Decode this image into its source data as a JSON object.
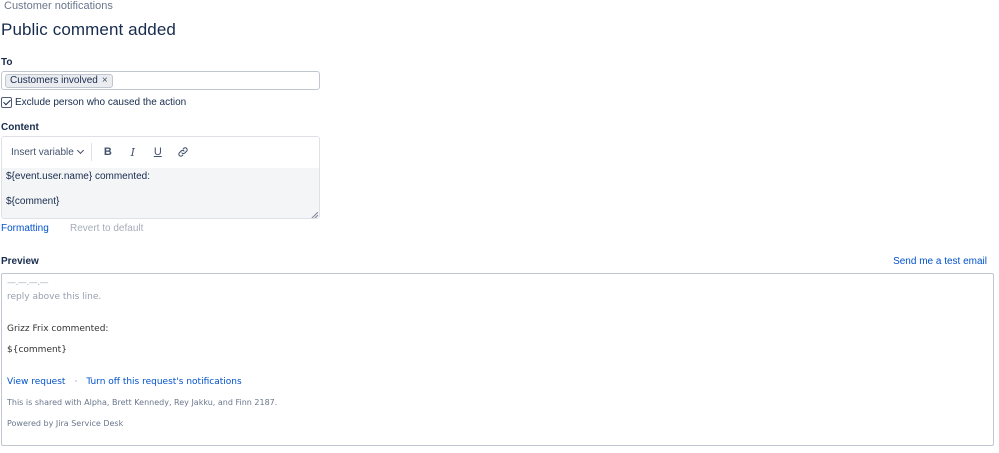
{
  "breadcrumb": "Customer notifications",
  "page_title": "Public comment added",
  "to": {
    "label": "To",
    "tags": [
      {
        "label": "Customers involved",
        "remove": "×"
      }
    ]
  },
  "exclude": {
    "label": "Exclude person who caused the action",
    "checked": true
  },
  "content": {
    "label": "Content",
    "toolbar": {
      "insert_variable": "Insert variable",
      "bold": "B",
      "italic": "I",
      "underline": "U",
      "link_icon": "link-icon"
    },
    "lines": [
      "${event.user.name} commented:",
      "${comment}"
    ]
  },
  "links": {
    "formatting": "Formatting",
    "revert": "Revert to default"
  },
  "preview": {
    "label": "Preview",
    "send_test": "Send me a test email",
    "dashes": "—.—.—.—",
    "reply_line": "reply above this line.",
    "commented": "Grizz Frix commented:",
    "comment": "${comment}",
    "view_request": "View request",
    "dot": "·",
    "turn_off": "Turn off this request's notifications",
    "shared": "This is shared with Alpha, Brett Kennedy, Rey Jakku, and Finn 2187.",
    "powered": "Powered by Jira Service Desk"
  },
  "colors": {
    "link": "#0052cc",
    "text": "#172b4d",
    "muted": "#6b778c",
    "border": "#c1c7d0"
  }
}
